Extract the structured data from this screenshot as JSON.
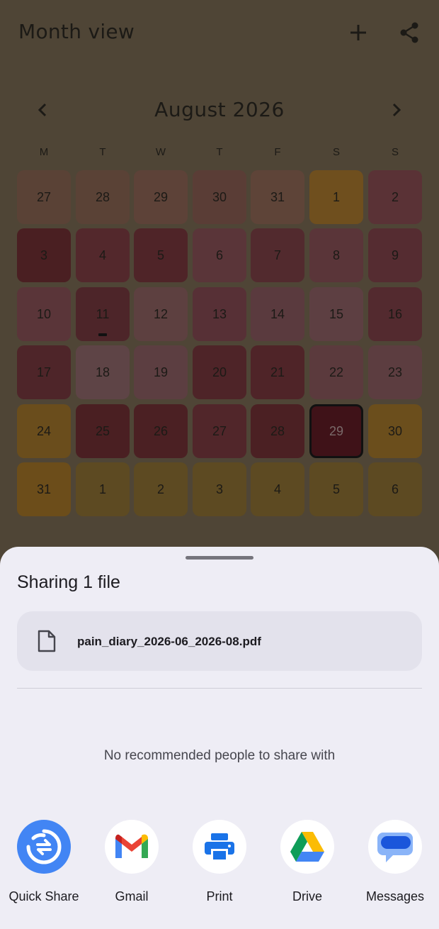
{
  "app": {
    "title": "Month view",
    "month_title": "August 2026",
    "weekdays": [
      "M",
      "T",
      "W",
      "T",
      "F",
      "S",
      "S"
    ],
    "days": [
      {
        "label": "27",
        "color": "#5a4236"
      },
      {
        "label": "28",
        "color": "#5a4236"
      },
      {
        "label": "29",
        "color": "#5d4238"
      },
      {
        "label": "30",
        "color": "#5a3d36"
      },
      {
        "label": "31",
        "color": "#5e4438"
      },
      {
        "label": "1",
        "color": "#6f4f1e"
      },
      {
        "label": "2",
        "color": "#5a3236"
      },
      {
        "label": "3",
        "color": "#4a1f22"
      },
      {
        "label": "4",
        "color": "#53282c"
      },
      {
        "label": "5",
        "color": "#4f2428"
      },
      {
        "label": "6",
        "color": "#5a3539"
      },
      {
        "label": "7",
        "color": "#522a2e"
      },
      {
        "label": "8",
        "color": "#5a3539"
      },
      {
        "label": "9",
        "color": "#552c31"
      },
      {
        "label": "10",
        "color": "#5a3539"
      },
      {
        "label": "11",
        "color": "#4d2529",
        "mark": true
      },
      {
        "label": "12",
        "color": "#5d4040"
      },
      {
        "label": "13",
        "color": "#573036"
      },
      {
        "label": "14",
        "color": "#5a3a3e"
      },
      {
        "label": "15",
        "color": "#5d3f42"
      },
      {
        "label": "16",
        "color": "#532a2f"
      },
      {
        "label": "17",
        "color": "#4e2529"
      },
      {
        "label": "18",
        "color": "#5e4446"
      },
      {
        "label": "19",
        "color": "#5c3e41"
      },
      {
        "label": "20",
        "color": "#4e2428"
      },
      {
        "label": "21",
        "color": "#4f2428"
      },
      {
        "label": "22",
        "color": "#5b3a3d"
      },
      {
        "label": "23",
        "color": "#5c3d40"
      },
      {
        "label": "24",
        "color": "#6a4d1c"
      },
      {
        "label": "25",
        "color": "#4a1f22"
      },
      {
        "label": "26",
        "color": "#4b2023"
      },
      {
        "label": "27",
        "color": "#51262a"
      },
      {
        "label": "28",
        "color": "#4b2023"
      },
      {
        "label": "29",
        "color": "#3f1218",
        "selected": true
      },
      {
        "label": "30",
        "color": "#6b4e1c"
      },
      {
        "label": "31",
        "color": "#6c4d1a"
      },
      {
        "label": "1",
        "color": "#5d4a22"
      },
      {
        "label": "2",
        "color": "#5d4a22"
      },
      {
        "label": "3",
        "color": "#5d4a22"
      },
      {
        "label": "4",
        "color": "#5d4a22"
      },
      {
        "label": "5",
        "color": "#5d4a22"
      },
      {
        "label": "6",
        "color": "#5d4a22"
      }
    ]
  },
  "sheet": {
    "title": "Sharing 1 file",
    "file_name": "pain_diary_2026-06_2026-08.pdf",
    "no_recommendations": "No recommended people to share with",
    "targets": [
      {
        "label": "Quick Share",
        "icon": "quick-share-icon"
      },
      {
        "label": "Gmail",
        "icon": "gmail-icon"
      },
      {
        "label": "Print",
        "icon": "print-icon"
      },
      {
        "label": "Drive",
        "icon": "drive-icon"
      },
      {
        "label": "Messages",
        "icon": "messages-icon"
      }
    ]
  },
  "colors": {
    "scrim_background": "#4f4536",
    "sheet_background": "#eeedf5",
    "quick_share_blue": "#4285f4"
  }
}
